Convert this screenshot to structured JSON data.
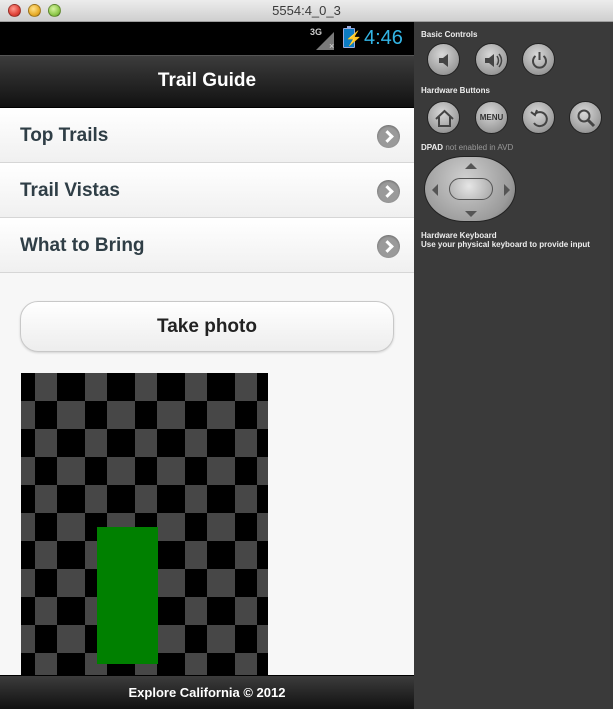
{
  "window": {
    "title": "5554:4_0_3"
  },
  "status_bar": {
    "network": "3G",
    "time": "4:46"
  },
  "header": {
    "title": "Trail Guide"
  },
  "menu": [
    {
      "label": "Top Trails"
    },
    {
      "label": "Trail Vistas"
    },
    {
      "label": "What to Bring"
    }
  ],
  "take_photo": {
    "label": "Take photo"
  },
  "footer": {
    "text": "Explore California © 2012"
  },
  "emulator_panel": {
    "basic_controls": "Basic Controls",
    "hardware_buttons": "Hardware Buttons",
    "menu_button": "MENU",
    "dpad_label": "DPAD",
    "dpad_note": "not enabled in AVD",
    "keyboard_title": "Hardware Keyboard",
    "keyboard_note": "Use your physical keyboard to provide input"
  },
  "colors": {
    "clock": "#33b5e5",
    "preview_rect": "#008000"
  }
}
